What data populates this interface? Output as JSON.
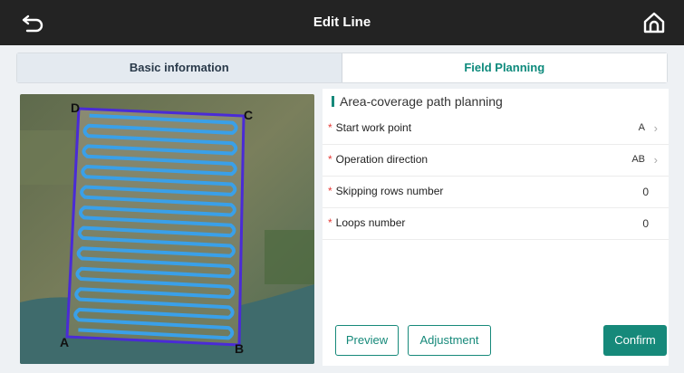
{
  "header": {
    "title": "Edit Line",
    "back_icon": "back-arrow-icon",
    "home_icon": "home-icon"
  },
  "tabs": [
    {
      "label": "Basic information",
      "active": false
    },
    {
      "label": "Field Planning",
      "active": true
    }
  ],
  "map": {
    "corners": [
      "A",
      "B",
      "C",
      "D"
    ],
    "path_color": "#3aa0e8",
    "boundary_color": "#4a2bd6"
  },
  "panel": {
    "title": "Area-coverage path planning",
    "fields": [
      {
        "label": "Start work point",
        "value": "A",
        "required": true
      },
      {
        "label": "Operation direction",
        "value": "AB",
        "required": true
      },
      {
        "label": "Skipping rows number",
        "value": "0",
        "required": true
      },
      {
        "label": "Loops number",
        "value": "0",
        "required": true
      }
    ],
    "required_mark": "*",
    "buttons": {
      "preview": "Preview",
      "adjustment": "Adjustment",
      "confirm": "Confirm"
    }
  },
  "colors": {
    "accent": "#16897a",
    "topbar": "#232323",
    "required": "#e53935"
  }
}
